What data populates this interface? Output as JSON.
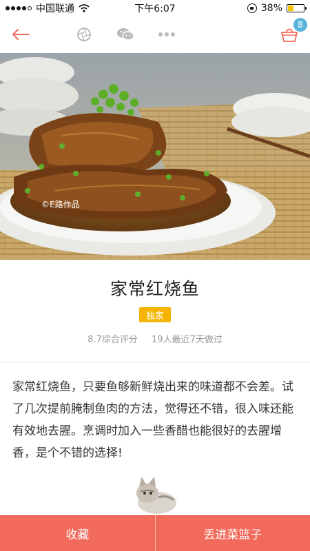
{
  "status_bar": {
    "carrier": "中国联通",
    "time": "下午6:07",
    "battery_percent": "38%",
    "battery_level": 0.38
  },
  "nav": {
    "back_icon": "back-arrow-icon",
    "shutter_icon": "shutter-icon",
    "wechat_icon": "wechat-icon",
    "more_icon": "more-dots-icon",
    "basket_icon": "basket-icon",
    "basket_count": "8",
    "accent": "#f26a5b"
  },
  "hero": {
    "watermark": "©E路作品"
  },
  "recipe": {
    "title": "家常红烧鱼",
    "tag": "独家",
    "rating": "8.7综合评分",
    "cooked": "19人最近7天做过",
    "description": "家常红烧鱼，只要鱼够新鲜烧出来的味道都不会差。试了几次提前腌制鱼肉的方法，觉得还不错，很入味还能有效地去腥。烹调时加入一些香醋也能很好的去腥增香，是个不错的选择!"
  },
  "actions": {
    "favorite": "收藏",
    "add_to_basket": "丢进菜篮子"
  }
}
